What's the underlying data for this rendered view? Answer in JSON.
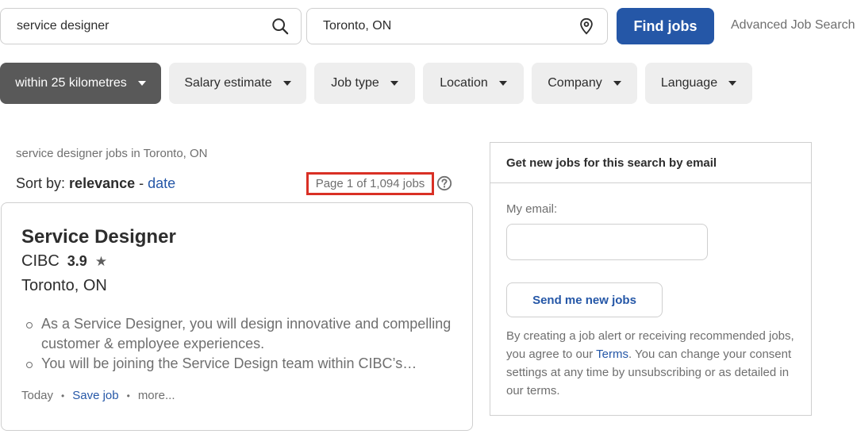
{
  "search": {
    "what_value": "service designer",
    "where_value": "Toronto, ON",
    "find_label": "Find jobs",
    "advanced_label": "Advanced Job Search"
  },
  "filters": [
    {
      "label": "within 25 kilometres",
      "active": true
    },
    {
      "label": "Salary estimate",
      "active": false
    },
    {
      "label": "Job type",
      "active": false
    },
    {
      "label": "Location",
      "active": false
    },
    {
      "label": "Company",
      "active": false
    },
    {
      "label": "Language",
      "active": false
    }
  ],
  "results": {
    "heading": "service designer jobs in Toronto, ON",
    "sort_prefix": "Sort by:",
    "sort_active": "relevance",
    "sort_separator": "-",
    "sort_alt": "date",
    "page_count": "Page 1 of 1,094 jobs"
  },
  "job": {
    "title": "Service Designer",
    "company": "CIBC",
    "rating": "3.9",
    "location": "Toronto, ON",
    "snippets": [
      "As a Service Designer, you will design innovative and compelling customer & employee experiences.",
      "You will be joining the Service Design team within CIBC’s…"
    ],
    "posted": "Today",
    "save_label": "Save job",
    "more_label": "more..."
  },
  "alert": {
    "header": "Get new jobs for this search by email",
    "email_label": "My email:",
    "email_value": "",
    "send_label": "Send me new jobs",
    "terms_before": "By creating a job alert or receiving recommended jobs, you agree to our ",
    "terms_link": "Terms",
    "terms_after": ". You can change your consent settings at any time by unsubscribing or as detailed in our terms."
  },
  "colors": {
    "primary": "#2557a7",
    "active_filter": "#595959",
    "highlight_border": "#d93025"
  }
}
